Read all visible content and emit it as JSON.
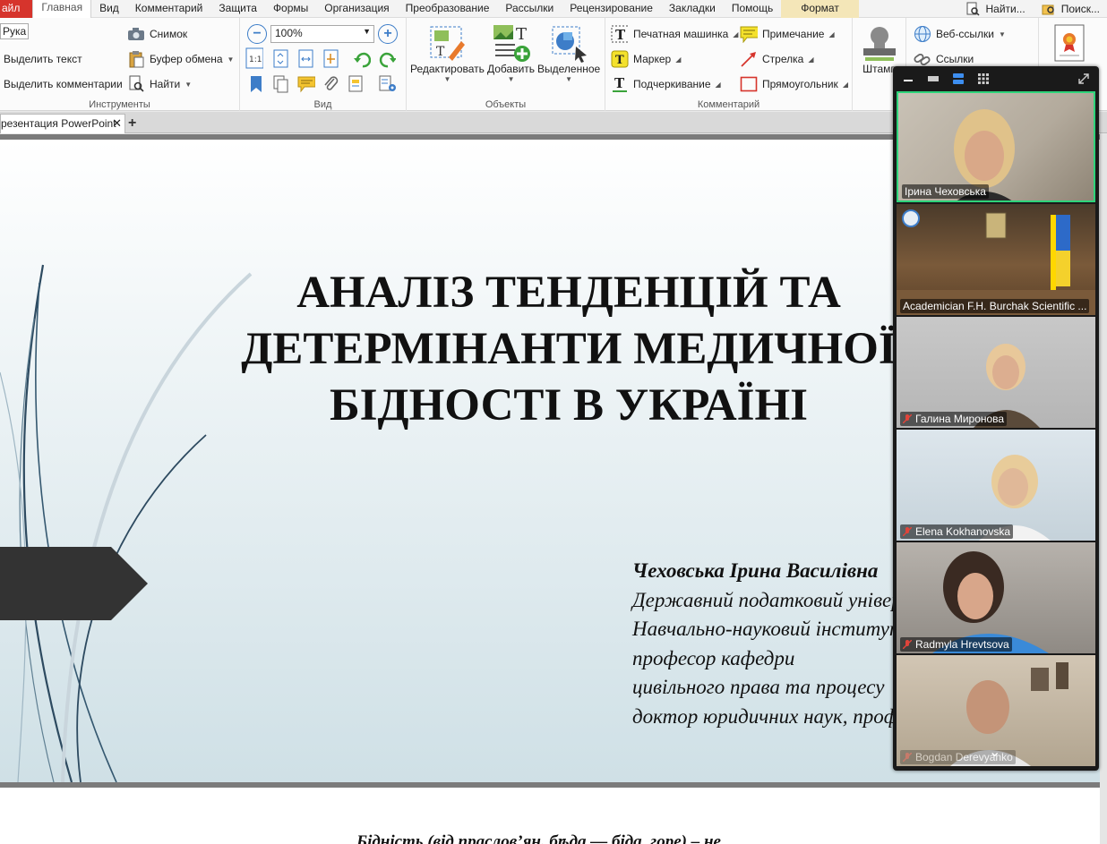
{
  "menu": {
    "file": "айл",
    "tabs": [
      "Главная",
      "Вид",
      "Комментарий",
      "Защита",
      "Формы",
      "Организация",
      "Преобразование",
      "Рассылки",
      "Рецензирование",
      "Закладки",
      "Помощь"
    ],
    "format": "Формат",
    "find": "Найти...",
    "search": "Поиск..."
  },
  "ribbon": {
    "tools": {
      "hand": "Рука",
      "select_text": "Выделить текст",
      "select_comments": "Выделить комментарии",
      "label": "Инструменты"
    },
    "clipboard": {
      "snapshot": "Снимок",
      "clipboard": "Буфер обмена",
      "find": "Найти"
    },
    "view": {
      "zoom": "100%",
      "label": "Вид"
    },
    "objects": {
      "edit": "Редактировать",
      "add": "Добавить",
      "selected": "Выделенное",
      "label": "Объекты"
    },
    "comments": {
      "typewriter": "Печатная машинка",
      "marker": "Маркер",
      "underline": "Подчеркивание",
      "note": "Примечание",
      "arrow": "Стрелка",
      "rectangle": "Прямоугольник",
      "label": "Комментарий"
    },
    "stamp": "Штамп",
    "links": {
      "web": "Веб-ссылки",
      "links": "Ссылки"
    }
  },
  "document": {
    "tab_title": "резентация PowerPoint",
    "title_lines": [
      "АНАЛІЗ ТЕНДЕНЦІЙ ТА",
      "ДЕТЕРМІНАНТИ МЕДИЧНОЇ",
      "БІДНОСТІ В УКРАЇНІ"
    ],
    "author_name": "Чеховська Ірина Василівна",
    "author_lines": [
      "Державний податковий університет",
      "Навчально-науковий інститут права",
      "професор кафедри",
      "цивільного права та процесу",
      "доктор юридичних наук, професор"
    ],
    "page2_text": "Бідність (від праслов’ян. бѣда — біда, горе) – не"
  },
  "video": {
    "participants": [
      {
        "name": "Ірина Чеховська",
        "muted": false,
        "active": true
      },
      {
        "name": "Academician F.H. Burchak Scientific ...",
        "muted": false,
        "active": false
      },
      {
        "name": "Галина Миронова",
        "muted": true,
        "active": false
      },
      {
        "name": "Elena Kokhanovska",
        "muted": true,
        "active": false
      },
      {
        "name": "Radmyla Hrevtsova",
        "muted": true,
        "active": false
      },
      {
        "name": "Bogdan Derevyanko",
        "muted": true,
        "active": false
      }
    ]
  }
}
